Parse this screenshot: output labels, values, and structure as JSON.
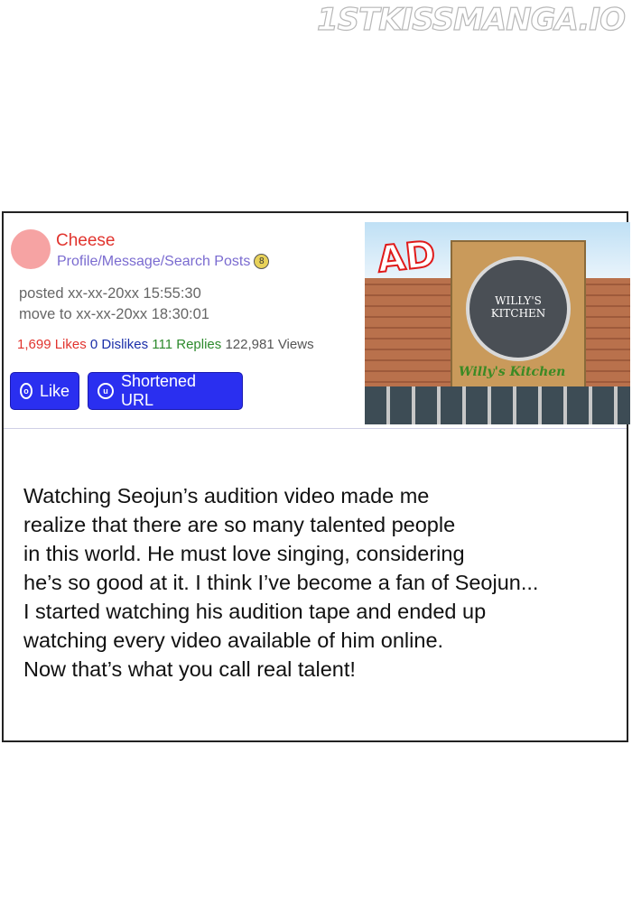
{
  "watermark": "1STKISSMANGA.IO",
  "post": {
    "username": "Cheese",
    "profile_links": "Profile/Message/Search Posts",
    "badge": "8",
    "posted": "posted xx-xx-20xx 15:55:30",
    "moved": "move to xx-xx-20xx 18:30:01",
    "stats": {
      "likes": "1,699 Likes",
      "dislikes": "0 Dislikes",
      "replies": "111 Replies",
      "views": "122,981 Views"
    },
    "buttons": {
      "like": "Like",
      "shortened_url": "Shortened URL"
    }
  },
  "ad": {
    "tag": "AD",
    "sign_text": "WILLY'S KITCHEN",
    "script_text": "Willy's Kitchen"
  },
  "body_lines": [
    "Watching Seojun’s audition video made me",
    "realize that there are so many talented people",
    "in this world. He must love singing, considering",
    "he’s so good at it. I think I’ve become a fan of Seojun...",
    "I started watching his audition tape and ended up",
    "watching every video available of him online.",
    "Now that’s what you call real talent!"
  ]
}
